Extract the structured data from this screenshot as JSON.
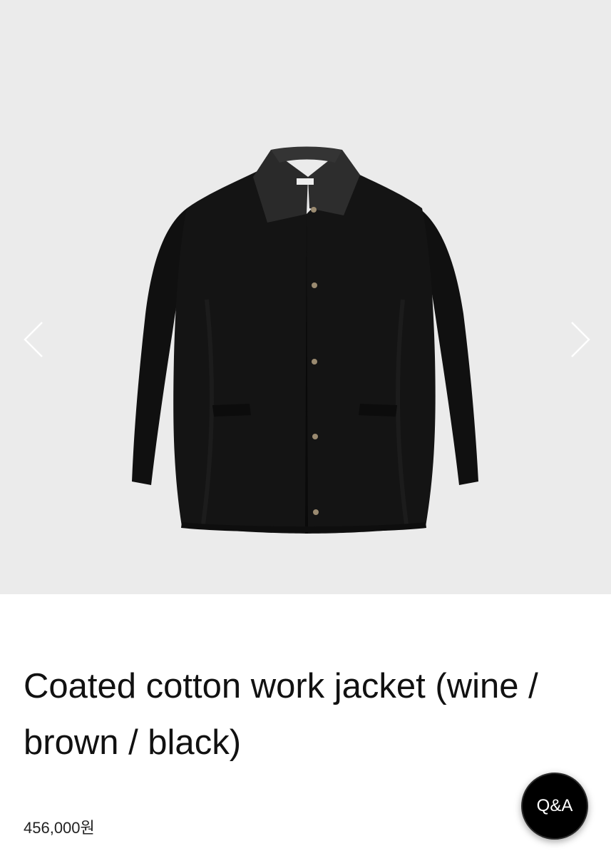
{
  "gallery": {
    "background_color": "#ebebeb",
    "image_alt": "black jacket with leather collar",
    "prev_icon": "chevron-left-icon",
    "next_icon": "chevron-right-icon"
  },
  "product": {
    "title": "Coated cotton work jacket (wine / brown / black)",
    "price": "456,000원"
  },
  "qa_button": {
    "label": "Q&A"
  },
  "colors": {
    "jacket": "#131313",
    "collar": "#2a2a2a",
    "snap_buttons": "#9a8a70"
  }
}
